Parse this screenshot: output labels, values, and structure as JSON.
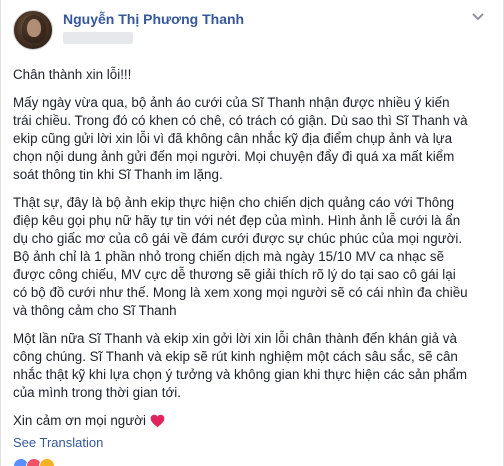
{
  "post": {
    "author_name": "Nguyễn Thị Phương Thanh",
    "paragraphs": [
      {
        "lines": [
          "Chân thành xin lỗi!!!"
        ]
      },
      {
        "lines": [
          "Mấy ngày vừa qua, bộ ảnh áo cưới của Sĩ Thanh nhận được nhiều ý kiến",
          "trái chiều. Trong đó có khen có chê, có trách có giận. Dù sao thì Sĩ Thanh và",
          "ekip cũng gửi lời xin lỗi vì đã không cân nhắc kỹ địa điểm chụp ảnh và lựa",
          "chọn nội dung ảnh gửi đến mọi người. Mọi chuyện đẩy đi quá xa mất kiểm",
          "soát thông tin khi Sĩ Thanh im lặng."
        ]
      },
      {
        "lines": [
          "Thật sự, đây là bộ ảnh ekip thực hiện cho chiến dịch quảng cáo với Thông",
          "điệp kêu gọi phụ nữ hãy tự tin với nét đẹp của mình. Hình ảnh lễ cưới là ẩn",
          "dụ cho giấc mơ của cô gái về đám cưới được sự chúc phúc của mọi người.",
          "Bộ ảnh chỉ là 1 phần nhỏ trong chiến dịch mà ngày 15/10 MV ca nhạc sẽ",
          "được công chiếu, MV cực dễ thương sẽ giải thích rõ lý do tại sao cô gái lại",
          "có bộ đồ cưới như thế. Mong là xem xong mọi người sẽ có cái nhìn đa chiều",
          "và thông cảm cho Sĩ Thanh"
        ]
      },
      {
        "lines": [
          "Một lần nữa Sĩ Thanh và ekip xin gởi lời xin lỗi chân thành đến khán giả và",
          "công chúng. Sĩ Thanh và ekip sẽ rút kinh nghiệm một cách sâu sắc, sẽ cân",
          "nhắc thật kỹ khi lựa chọn ý tưởng và không gian khi thực hiện các sản phẩm",
          "của mình trong thời gian tới."
        ]
      }
    ],
    "closing": "Xin cảm ơn mọi người",
    "see_translation": "See Translation"
  },
  "icons": {
    "menu": "chevron-down-icon",
    "heart": "heart-icon",
    "reactions": [
      "like-reaction-icon",
      "love-reaction-icon",
      "wow-reaction-icon"
    ]
  },
  "colors": {
    "link": "#365899",
    "text": "#1d2129",
    "heart": "#e0245e",
    "like": "#5890ff",
    "love": "#f25268",
    "wow": "#f7b125"
  }
}
